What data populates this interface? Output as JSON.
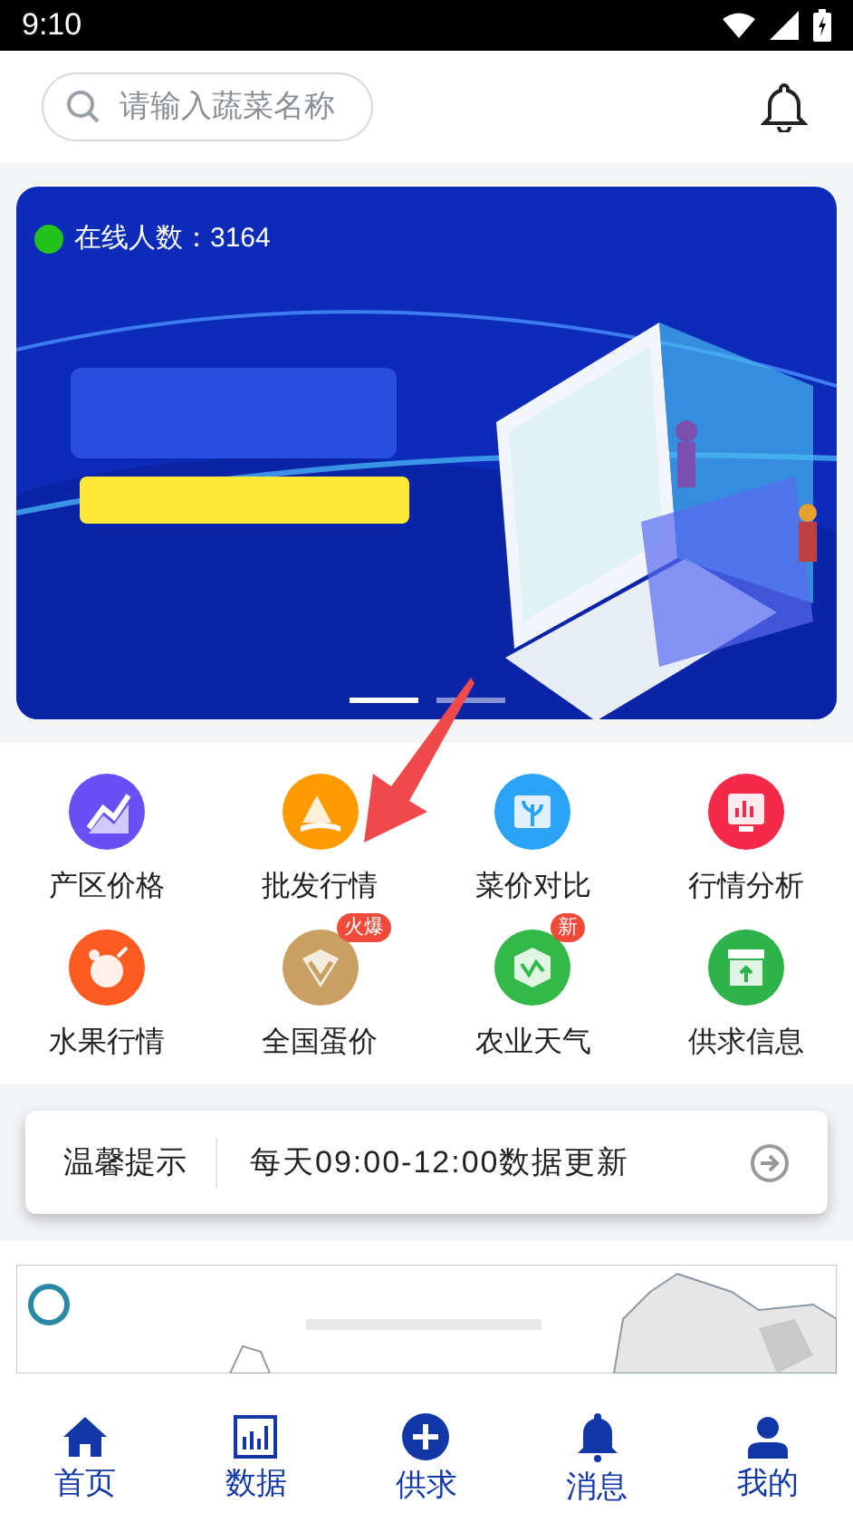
{
  "status_bar": {
    "time": "9:10"
  },
  "search": {
    "placeholder": "请输入蔬菜名称"
  },
  "banner": {
    "kind": "picture",
    "online_label": "在线人数：3164",
    "dots": [
      {
        "selected": true
      },
      {
        "selected": false
      }
    ]
  },
  "features": [
    {
      "label": "产区价格",
      "color": "#6a4ff5",
      "kind": "trend"
    },
    {
      "label": "批发行情",
      "color": "#ff9a00",
      "kind": "mountain"
    },
    {
      "label": "菜价对比",
      "color": "#2aa2f5",
      "kind": "book"
    },
    {
      "label": "行情分析",
      "color": "#f5294a",
      "kind": "screen"
    },
    {
      "label": "水果行情",
      "color": "#ff5a1f",
      "kind": "fruit"
    },
    {
      "label": "全国蛋价",
      "color": "#c9a062",
      "kind": "gem",
      "badge": "火爆"
    },
    {
      "label": "农业天气",
      "color": "#33b84a",
      "kind": "hex",
      "badge": "新"
    },
    {
      "label": "供求信息",
      "color": "#2db34a",
      "kind": "box"
    }
  ],
  "notice": {
    "title": "温馨提示",
    "message": "每天09:00-12:00数据更新"
  },
  "tab_bar": [
    {
      "label": "首页",
      "kind": "home"
    },
    {
      "label": "数据",
      "kind": "chart"
    },
    {
      "label": "供求",
      "kind": "plus"
    },
    {
      "label": "消息",
      "kind": "bell"
    },
    {
      "label": "我的",
      "kind": "user"
    }
  ]
}
